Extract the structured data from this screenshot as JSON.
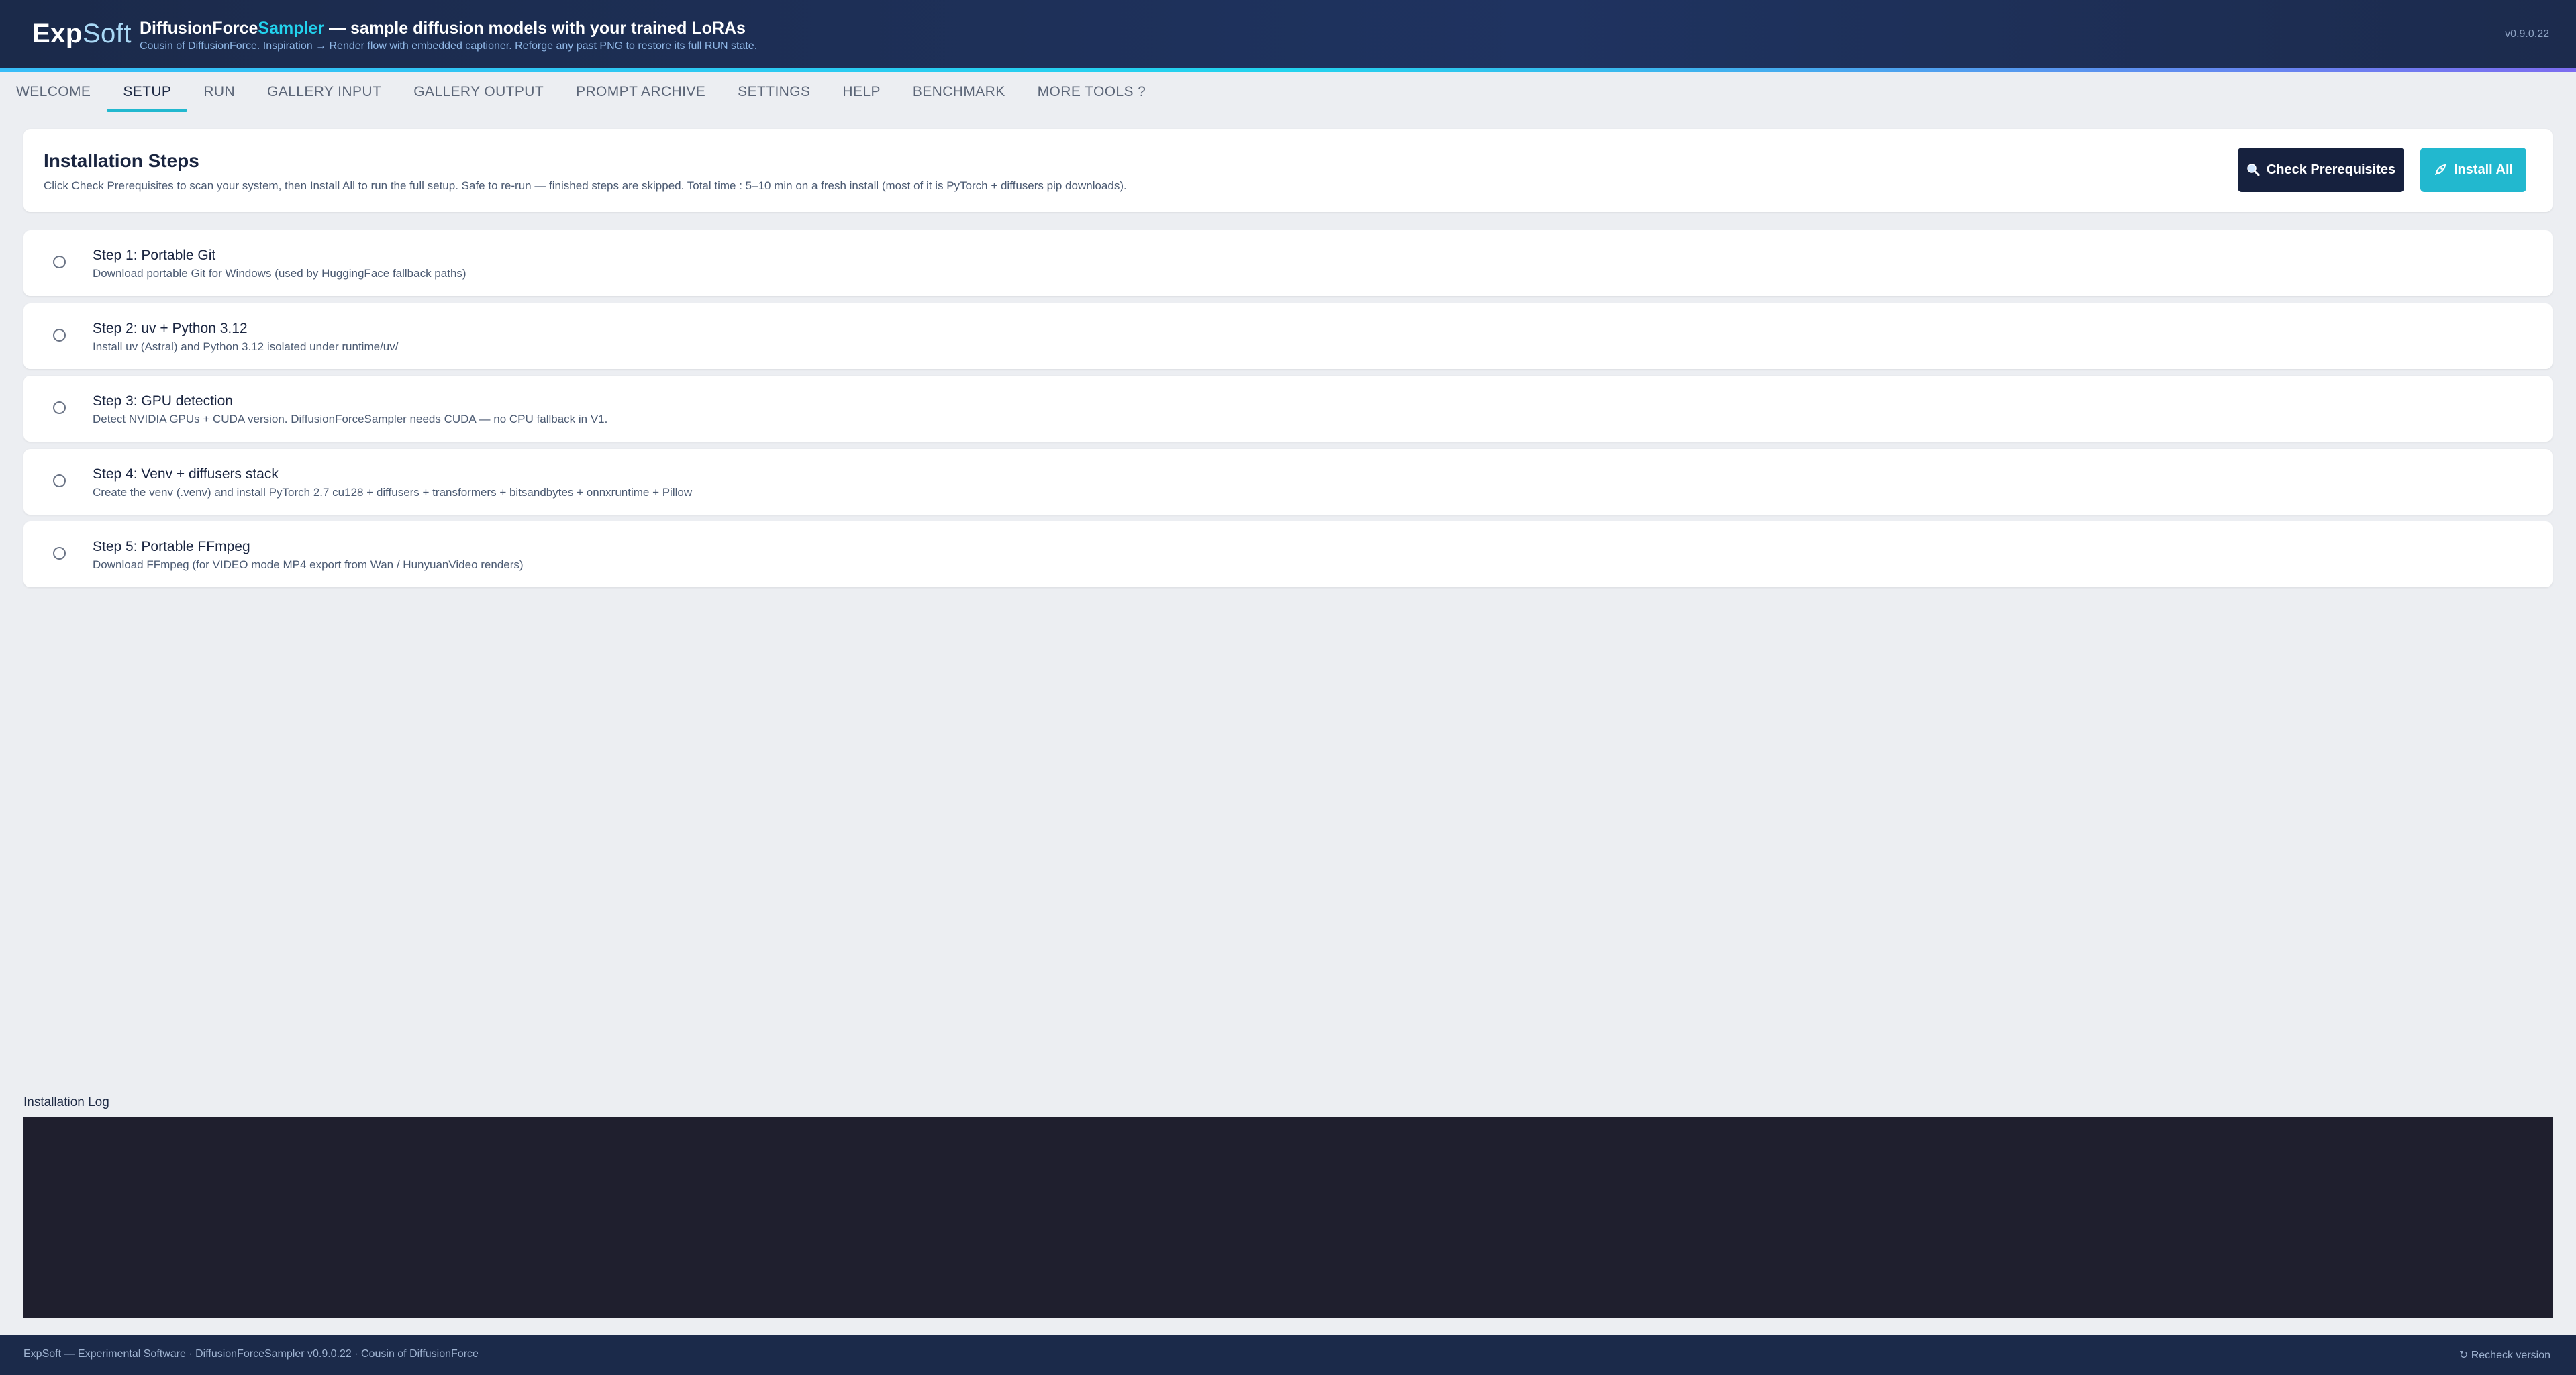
{
  "header": {
    "logo_exp": "Exp",
    "logo_soft": "Soft",
    "title_part1": "DiffusionForce",
    "title_accent": "Sampler",
    "title_part2": " — sample diffusion models with your trained LoRAs",
    "subtitle": "Cousin of DiffusionForce. Inspiration → Render flow with embedded captioner. Reforge any past PNG to restore its full RUN state.",
    "version": "v0.9.0.22"
  },
  "tabs": [
    {
      "label": "WELCOME"
    },
    {
      "label": "SETUP",
      "active": true
    },
    {
      "label": "RUN"
    },
    {
      "label": "GALLERY INPUT"
    },
    {
      "label": "GALLERY OUTPUT"
    },
    {
      "label": "PROMPT ARCHIVE"
    },
    {
      "label": "SETTINGS"
    },
    {
      "label": "HELP"
    },
    {
      "label": "BENCHMARK"
    },
    {
      "label": "MORE TOOLS ?"
    }
  ],
  "install": {
    "title": "Installation Steps",
    "description": "Click Check Prerequisites to scan your system, then Install All to run the full setup. Safe to re-run — finished steps are skipped. Total time : 5–10 min on a fresh install (most of it is PyTorch + diffusers pip downloads).",
    "check_button": "Check Prerequisites",
    "install_button": "Install All"
  },
  "steps": [
    {
      "title": "Step 1: Portable Git",
      "desc": "Download portable Git for Windows (used by HuggingFace fallback paths)"
    },
    {
      "title": "Step 2: uv + Python 3.12",
      "desc": "Install uv (Astral) and Python 3.12 isolated under runtime/uv/"
    },
    {
      "title": "Step 3: GPU detection",
      "desc": "Detect NVIDIA GPUs + CUDA version. DiffusionForceSampler needs CUDA — no CPU fallback in V1."
    },
    {
      "title": "Step 4: Venv + diffusers stack",
      "desc": "Create the venv (.venv) and install PyTorch 2.7 cu128 + diffusers + transformers + bitsandbytes + onnxruntime + Pillow"
    },
    {
      "title": "Step 5: Portable FFmpeg",
      "desc": "Download FFmpeg (for VIDEO mode MP4 export from Wan / HunyuanVideo renders)"
    }
  ],
  "log": {
    "label": "Installation Log",
    "content": ""
  },
  "footer": {
    "text": "ExpSoft — Experimental Software · DiffusionForceSampler v0.9.0.22 · Cousin of DiffusionForce",
    "recheck": "↻ Recheck version"
  },
  "colors": {
    "header_bg": "#1b2a4a",
    "accent": "#22b8cf",
    "button_dark": "#16213e",
    "log_bg": "#1f1f2e",
    "page_bg": "#eceef2"
  },
  "icons": {
    "check_button_icon": "magnifier-icon",
    "install_button_icon": "rocket-icon",
    "step_status_icon": "radio-empty-icon"
  }
}
